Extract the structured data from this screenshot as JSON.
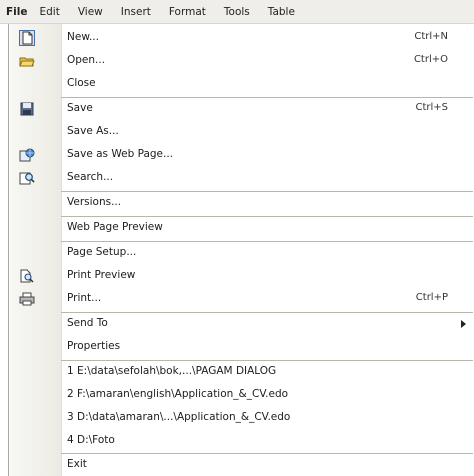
{
  "menubar": {
    "items": [
      "File",
      "Edit",
      "View",
      "Insert",
      "Format",
      "Tools",
      "Table"
    ]
  },
  "file_menu": {
    "items": [
      {
        "label": "New...",
        "shortcut": "Ctrl+N",
        "icon": "new-document-icon"
      },
      {
        "label": "Open...",
        "shortcut": "Ctrl+O",
        "icon": "open-folder-icon"
      },
      {
        "label": "Close",
        "shortcut": "",
        "icon": ""
      },
      {
        "label": "Save",
        "shortcut": "Ctrl+S",
        "icon": "save-icon"
      },
      {
        "label": "Save As...",
        "shortcut": "",
        "icon": ""
      },
      {
        "label": "Save as Web Page...",
        "shortcut": "",
        "icon": "web-page-icon"
      },
      {
        "label": "Search...",
        "shortcut": "",
        "icon": "search-icon"
      },
      {
        "label": "Versions...",
        "shortcut": "",
        "icon": ""
      },
      {
        "label": "Web Page Preview",
        "shortcut": "",
        "icon": ""
      },
      {
        "label": "Page Setup...",
        "shortcut": "",
        "icon": ""
      },
      {
        "label": "Print Preview",
        "shortcut": "",
        "icon": "print-preview-icon"
      },
      {
        "label": "Print...",
        "shortcut": "Ctrl+P",
        "icon": "printer-icon"
      },
      {
        "label": "Send To",
        "shortcut": "",
        "icon": "",
        "submenu": true
      },
      {
        "label": "Properties",
        "shortcut": "",
        "icon": ""
      },
      {
        "label": "1 E:\\data\\sefolah\\bok,...\\PAGAM DIALOG",
        "shortcut": "",
        "icon": ""
      },
      {
        "label": "2 F:\\amaran\\english\\Application_&_CV.edo",
        "shortcut": "",
        "icon": ""
      },
      {
        "label": "3 D:\\data\\amaran\\...\\Application_&_CV.edo",
        "shortcut": "",
        "icon": ""
      },
      {
        "label": "4 D:\\Foto",
        "shortcut": "",
        "icon": ""
      },
      {
        "label": "Exit",
        "shortcut": "",
        "icon": ""
      }
    ]
  }
}
